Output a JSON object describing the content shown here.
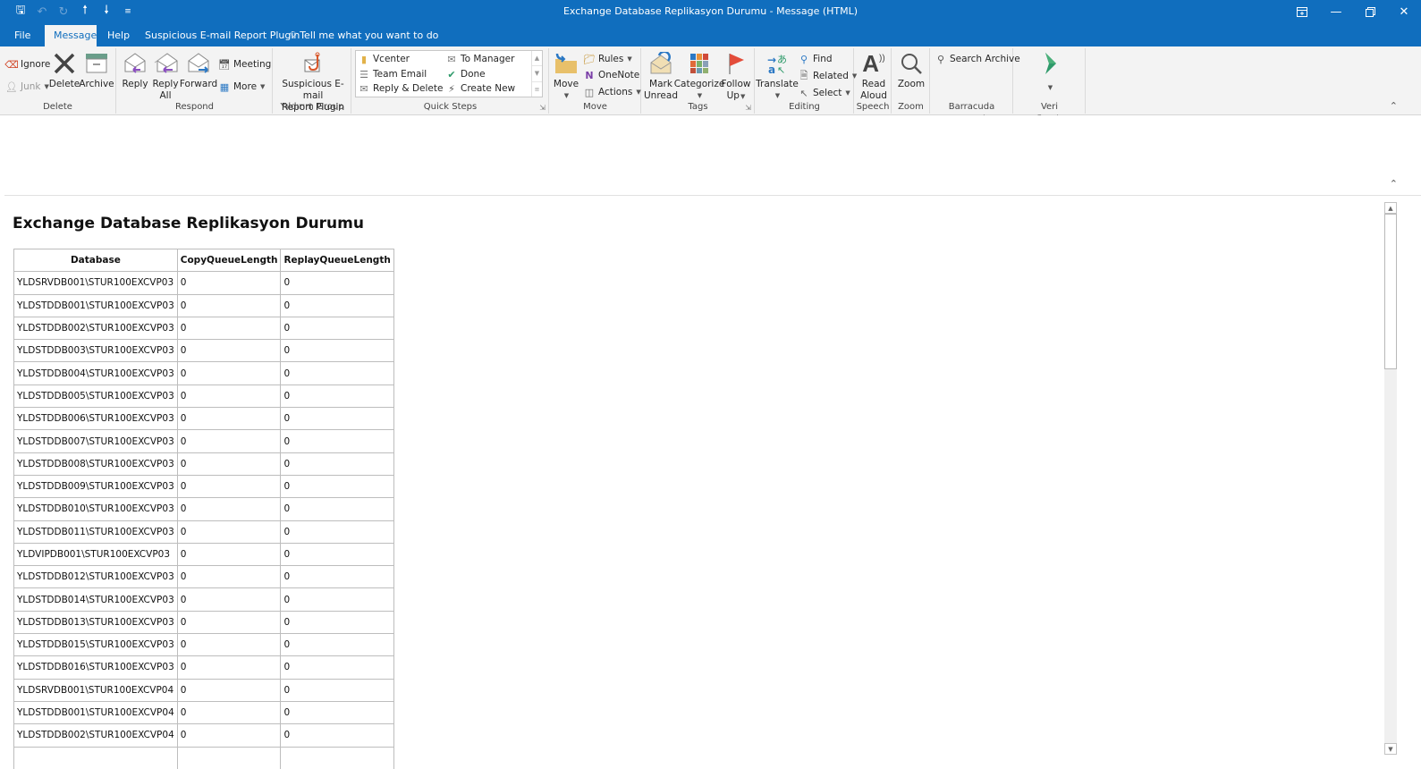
{
  "window": {
    "title": "Exchange Database Replikasyon Durumu  -  Message (HTML)",
    "qat_icons": [
      "save-icon",
      "undo-icon",
      "redo-icon",
      "up-arrow-icon",
      "down-arrow-icon",
      "customize-icon"
    ],
    "controls": [
      "ribbon-display-options",
      "minimize",
      "restore",
      "close"
    ]
  },
  "tabs": [
    {
      "label": "File",
      "active": false
    },
    {
      "label": "Message",
      "active": true
    },
    {
      "label": "Help",
      "active": false
    },
    {
      "label": "Suspicious E-mail Report Plugin",
      "active": false
    }
  ],
  "tell_me": "Tell me what you want to do",
  "ribbon": {
    "delete_group": {
      "label": "Delete",
      "ignore": "Ignore",
      "junk": "Junk",
      "delete": "Delete",
      "archive": "Archive"
    },
    "respond_group": {
      "label": "Respond",
      "reply": "Reply",
      "reply_all_1": "Reply",
      "reply_all_2": "All",
      "forward": "Forward",
      "meeting": "Meeting",
      "more": "More"
    },
    "yildirim_group": {
      "label": "Yıldırım Group",
      "plugin_1": "Suspicious E-mail",
      "plugin_2": "Report Plugin"
    },
    "quick_steps": {
      "label": "Quick Steps",
      "items": [
        "Vcenter",
        "To Manager",
        "Team Email",
        "Done",
        "Reply & Delete",
        "Create New"
      ]
    },
    "move_group": {
      "label": "Move",
      "move": "Move",
      "rules": "Rules",
      "onenote": "OneNote",
      "actions": "Actions"
    },
    "tags_group": {
      "label": "Tags",
      "mark_unread_1": "Mark",
      "mark_unread_2": "Unread",
      "categorize": "Categorize",
      "follow_up_1": "Follow",
      "follow_up_2": "Up"
    },
    "editing_group": {
      "label": "Editing",
      "translate": "Translate",
      "find": "Find",
      "related": "Related",
      "select": "Select"
    },
    "speech_group": {
      "label": "Speech",
      "read_aloud_1": "Read",
      "read_aloud_2": "Aloud"
    },
    "zoom_group": {
      "label": "Zoom",
      "zoom": "Zoom"
    },
    "barracuda_group": {
      "label": "Barracuda Networks",
      "search_archive": "Search Archive"
    },
    "veri_group": {
      "label": "Veri Sınıflandırma"
    }
  },
  "message": {
    "heading": "Exchange Database Replikasyon Durumu",
    "table": {
      "headers": [
        "Database",
        "CopyQueueLength",
        "ReplayQueueLength"
      ],
      "rows": [
        [
          "YLDSRVDB001\\STUR100EXCVP03",
          "0",
          "0"
        ],
        [
          "YLDSTDDB001\\STUR100EXCVP03",
          "0",
          "0"
        ],
        [
          "YLDSTDDB002\\STUR100EXCVP03",
          "0",
          "0"
        ],
        [
          "YLDSTDDB003\\STUR100EXCVP03",
          "0",
          "0"
        ],
        [
          "YLDSTDDB004\\STUR100EXCVP03",
          "0",
          "0"
        ],
        [
          "YLDSTDDB005\\STUR100EXCVP03",
          "0",
          "0"
        ],
        [
          "YLDSTDDB006\\STUR100EXCVP03",
          "0",
          "0"
        ],
        [
          "YLDSTDDB007\\STUR100EXCVP03",
          "0",
          "0"
        ],
        [
          "YLDSTDDB008\\STUR100EXCVP03",
          "0",
          "0"
        ],
        [
          "YLDSTDDB009\\STUR100EXCVP03",
          "0",
          "0"
        ],
        [
          "YLDSTDDB010\\STUR100EXCVP03",
          "0",
          "0"
        ],
        [
          "YLDSTDDB011\\STUR100EXCVP03",
          "0",
          "0"
        ],
        [
          "YLDVIPDB001\\STUR100EXCVP03",
          "0",
          "0"
        ],
        [
          "YLDSTDDB012\\STUR100EXCVP03",
          "0",
          "0"
        ],
        [
          "YLDSTDDB014\\STUR100EXCVP03",
          "0",
          "0"
        ],
        [
          "YLDSTDDB013\\STUR100EXCVP03",
          "0",
          "0"
        ],
        [
          "YLDSTDDB015\\STUR100EXCVP03",
          "0",
          "0"
        ],
        [
          "YLDSTDDB016\\STUR100EXCVP03",
          "0",
          "0"
        ],
        [
          "YLDSRVDB001\\STUR100EXCVP04",
          "0",
          "0"
        ],
        [
          "YLDSTDDB001\\STUR100EXCVP04",
          "0",
          "0"
        ],
        [
          "YLDSTDDB002\\STUR100EXCVP04",
          "0",
          "0"
        ],
        [
          "",
          "",
          ""
        ]
      ]
    }
  },
  "colors": {
    "accent": "#106ebe",
    "ribbon_bg": "#f3f3f3"
  }
}
